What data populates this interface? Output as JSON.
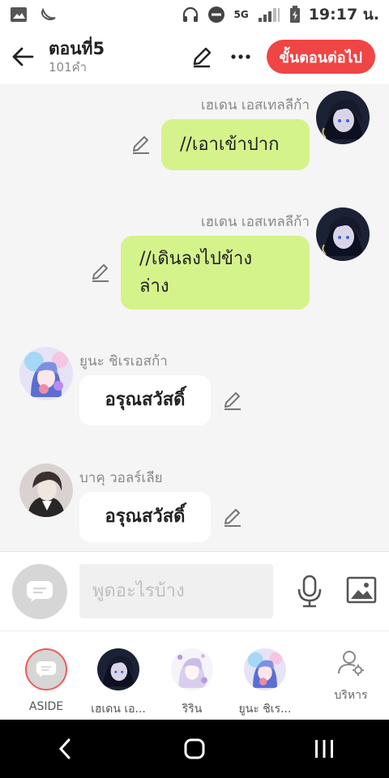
{
  "status": {
    "time": "19:17 น.",
    "network": "5G"
  },
  "header": {
    "title": "ตอนที่5",
    "subtitle": "101คำ",
    "next_label": "ขั้นตอนต่อไป"
  },
  "messages": [
    {
      "sender": "เฮเดน เอสเทลลีก้า",
      "text": "//เอาเข้าปาก",
      "side": "right"
    },
    {
      "sender": "เฮเดน เอสเทลลีก้า",
      "text_line1": "//เดินลงไปข้าง",
      "text_line2": "ล่าง",
      "side": "right"
    },
    {
      "sender": "ยูนะ ชิเรเอสก้า",
      "text": "อรุณสวัสดิ์",
      "side": "left"
    },
    {
      "sender": "บาคุ วอลร์เลีย",
      "text": "อรุณสวัสดิ์",
      "side": "left"
    }
  ],
  "input": {
    "placeholder": "พูดอะไรบ้าง"
  },
  "characters": [
    {
      "label": "ASIDE"
    },
    {
      "label": "เฮเดน เอ..."
    },
    {
      "label": "ริริน"
    },
    {
      "label": "ยูนะ ชิเร..."
    }
  ],
  "manage": {
    "label": "บริหาร"
  },
  "colors": {
    "accent": "#f04545",
    "bubble_right": "#d5f38b",
    "bubble_left": "#ffffff"
  }
}
